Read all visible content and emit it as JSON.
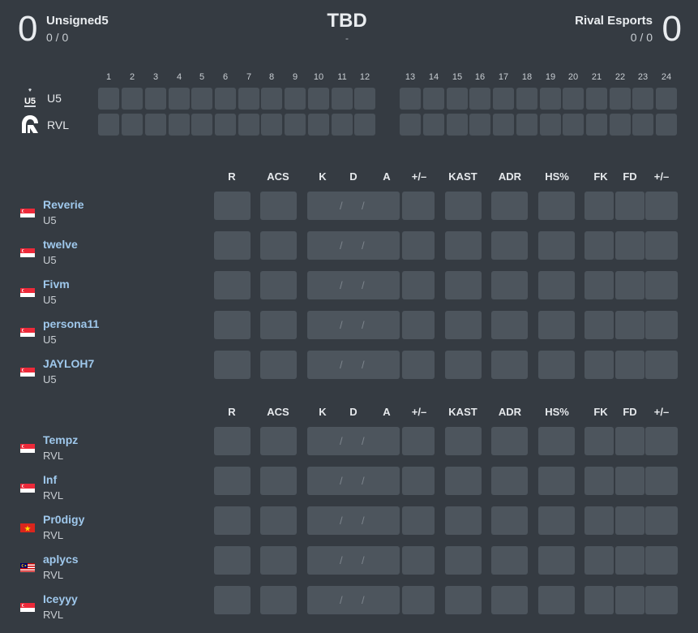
{
  "header": {
    "left_score": "0",
    "left_team": "Unsigned5",
    "left_record": "0 / 0",
    "map": "TBD",
    "map_sub": "-",
    "right_team": "Rival Esports",
    "right_record": "0 / 0",
    "right_score": "0"
  },
  "rounds": {
    "numbers": [
      "1",
      "2",
      "3",
      "4",
      "5",
      "6",
      "7",
      "8",
      "9",
      "10",
      "11",
      "12",
      "13",
      "14",
      "15",
      "16",
      "17",
      "18",
      "19",
      "20",
      "21",
      "22",
      "23",
      "24"
    ],
    "team_a": "U5",
    "team_b": "RVL"
  },
  "stat_headers": [
    "R",
    "ACS",
    "K",
    "D",
    "A",
    "+/–",
    "KAST",
    "ADR",
    "HS%",
    "FK",
    "FD",
    "+/–"
  ],
  "kda_slash": "/",
  "team_a_players": [
    {
      "name": "Reverie",
      "team": "U5",
      "flag": "sg"
    },
    {
      "name": "twelve",
      "team": "U5",
      "flag": "sg"
    },
    {
      "name": "Fivm",
      "team": "U5",
      "flag": "sg"
    },
    {
      "name": "persona11",
      "team": "U5",
      "flag": "sg"
    },
    {
      "name": "JAYLOH7",
      "team": "U5",
      "flag": "sg"
    }
  ],
  "team_b_players": [
    {
      "name": "Tempz",
      "team": "RVL",
      "flag": "sg"
    },
    {
      "name": "Inf",
      "team": "RVL",
      "flag": "sg"
    },
    {
      "name": "Pr0digy",
      "team": "RVL",
      "flag": "vn"
    },
    {
      "name": "aplycs",
      "team": "RVL",
      "flag": "my"
    },
    {
      "name": "Iceyyy",
      "team": "RVL",
      "flag": "sg"
    }
  ],
  "colors": {
    "background": "#353b42",
    "cell": "#4d555d",
    "player_link": "#9fc8ec"
  }
}
